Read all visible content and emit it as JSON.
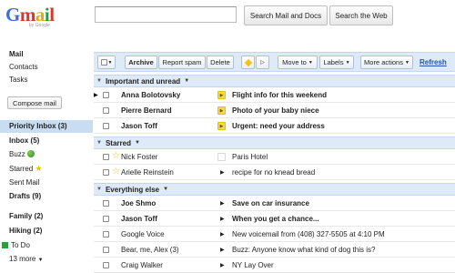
{
  "logo": {
    "letters": [
      "G",
      "m",
      "a",
      "i",
      "l"
    ],
    "sub": "by Google"
  },
  "header": {
    "search_mail_label": "Search Mail and Docs",
    "search_web_label": "Search the Web",
    "search_value": ""
  },
  "nav": {
    "mail": "Mail",
    "contacts": "Contacts",
    "tasks": "Tasks",
    "compose": "Compose mail",
    "priority_inbox": "Priority Inbox (3)",
    "inbox": "Inbox (5)",
    "buzz": "Buzz",
    "starred": "Starred",
    "sent": "Sent Mail",
    "drafts": "Drafts (9)",
    "family": "Family (2)",
    "hiking": "Hiking (2)",
    "todo": "To Do",
    "more": "13 more"
  },
  "toolbar": {
    "archive": "Archive",
    "report_spam": "Report spam",
    "delete": "Delete",
    "move_to": "Move to",
    "labels": "Labels",
    "more_actions": "More actions",
    "refresh": "Refresh"
  },
  "sections": {
    "important": "Important and unread",
    "starred": "Starred",
    "everything": "Everything else"
  },
  "rows": [
    {
      "sender": "Anna Bolotovsky",
      "subject": "Flight info for this weekend"
    },
    {
      "sender": "Pierre Bernard",
      "subject": "Photo of your baby niece"
    },
    {
      "sender": "Jason Toff",
      "subject": "Urgent: need your address"
    },
    {
      "sender": "Nick Foster",
      "subject": "Paris Hotel"
    },
    {
      "sender": "Arielle Reinstein",
      "subject": "recipe for no knead bread"
    },
    {
      "sender": "Joe Shmo",
      "subject": "Save on car insurance"
    },
    {
      "sender": "Jason Toff",
      "subject": "When you get a chance..."
    },
    {
      "sender": "Google Voice",
      "subject": "New voicemail from (408) 327-5505 at 4:10 PM"
    },
    {
      "sender": "Bear, me, Alex (3)",
      "subject": "Buzz: Anyone know what kind of dog this is?"
    },
    {
      "sender": "Craig Walker",
      "subject": "NY Lay Over"
    }
  ],
  "colors": {
    "accent": "#2155b0",
    "selected_bg": "#c8dcf2",
    "toolbar_bg": "#dfeaf8",
    "important_marker": "#f7dc3f",
    "star": "#e8c200"
  }
}
